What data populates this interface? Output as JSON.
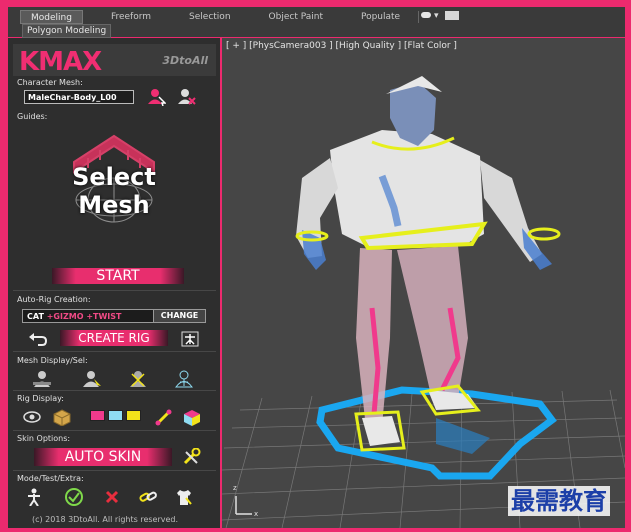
{
  "ribbon": {
    "tabs": [
      "Modeling",
      "Freeform",
      "Selection",
      "Object Paint",
      "Populate"
    ],
    "active_tab": "Modeling",
    "sub_tab": "Polygon Modeling"
  },
  "panel": {
    "logo_main": "KMAX",
    "logo_sub": "3DtoAll",
    "character_mesh_label": "Character Mesh:",
    "character_mesh_value": "MaleChar-Body_L00",
    "guides_label": "Guides:",
    "select_line1": "Select",
    "select_line2": "Mesh",
    "start_label": "START",
    "auto_rig_label": "Auto-Rig Creation:",
    "rig_type_cat": "CAT",
    "rig_type_gizmo": "+GIZMO",
    "rig_type_twist": "+TWIST",
    "change_label": "CHANGE",
    "create_rig_label": "CREATE RIG",
    "mesh_display_label": "Mesh Display/Sel:",
    "rig_display_label": "Rig Display:",
    "skin_options_label": "Skin Options:",
    "auto_skin_label": "AUTO SKIN",
    "mode_label": "Mode/Test/Extra:",
    "copyright": "(c) 2018 3DtoAll. All rights reserved."
  },
  "viewport": {
    "label": "[ + ] [PhysCamera003 ] [High Quality ] [Flat Color ]",
    "axis_x": "x",
    "axis_z": "z"
  },
  "watermark": "最需教育",
  "colors": {
    "frame": "#ec2a6e",
    "accent": "#e82e6e",
    "swatch_pink": "#f03a8c",
    "swatch_cyan": "#8fdcf2",
    "swatch_yellow": "#f2e31a",
    "guide_yellow": "#e6ef1c",
    "guide_cyan": "#1aa7f0"
  },
  "icons": [
    "user-pick-icon",
    "user-remove-icon",
    "undo-arrow-icon",
    "skeleton-icon",
    "mesh-display-icon",
    "mesh-select-icon",
    "mesh-hide-icon",
    "mesh-wire-icon",
    "bone-display-icon",
    "cube-icon",
    "bone-icon",
    "color-cube-icon",
    "wrench-icon",
    "stand-pose-icon",
    "check-icon",
    "delete-icon",
    "link-icon",
    "shirt-icon"
  ]
}
